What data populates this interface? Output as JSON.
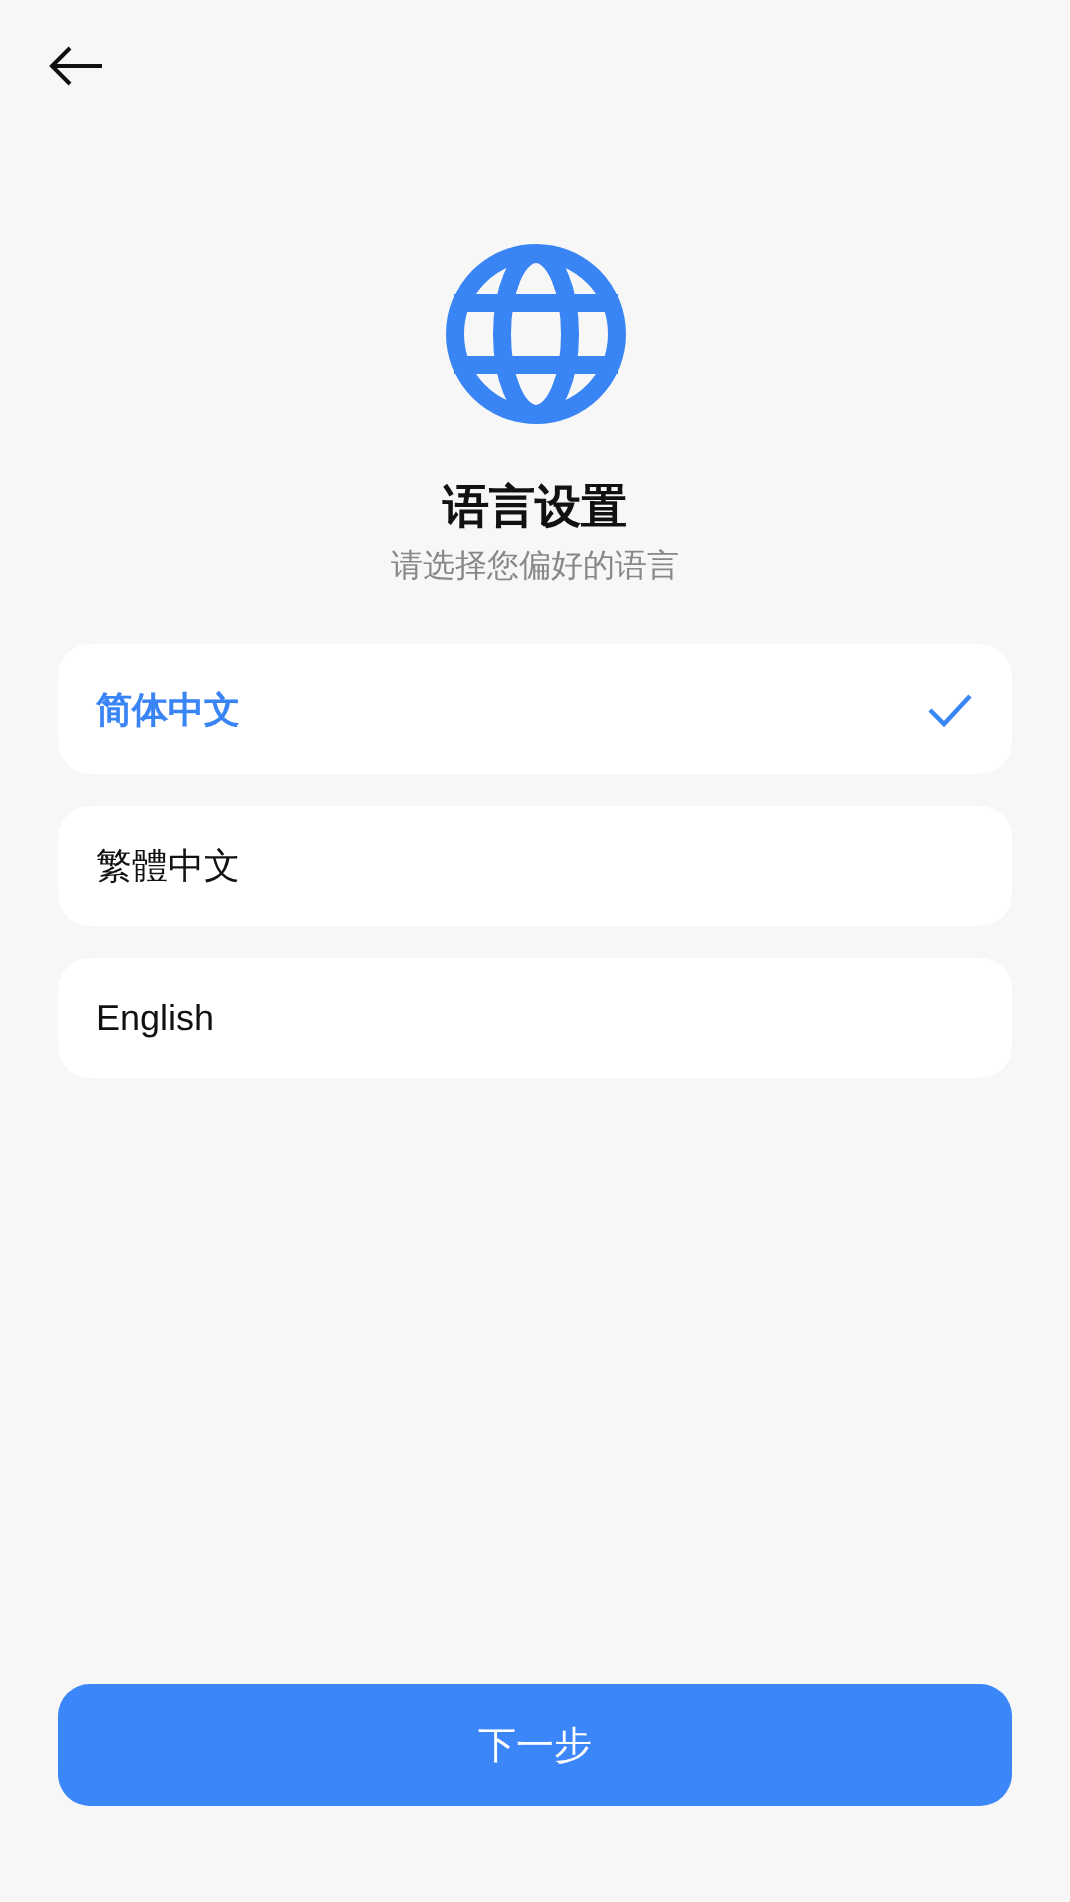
{
  "title": "语言设置",
  "subtitle": "请选择您偏好的语言",
  "languages": [
    {
      "label": "简体中文",
      "selected": true
    },
    {
      "label": "繁體中文",
      "selected": false
    },
    {
      "label": "English",
      "selected": false
    }
  ],
  "next_button": "下一步"
}
